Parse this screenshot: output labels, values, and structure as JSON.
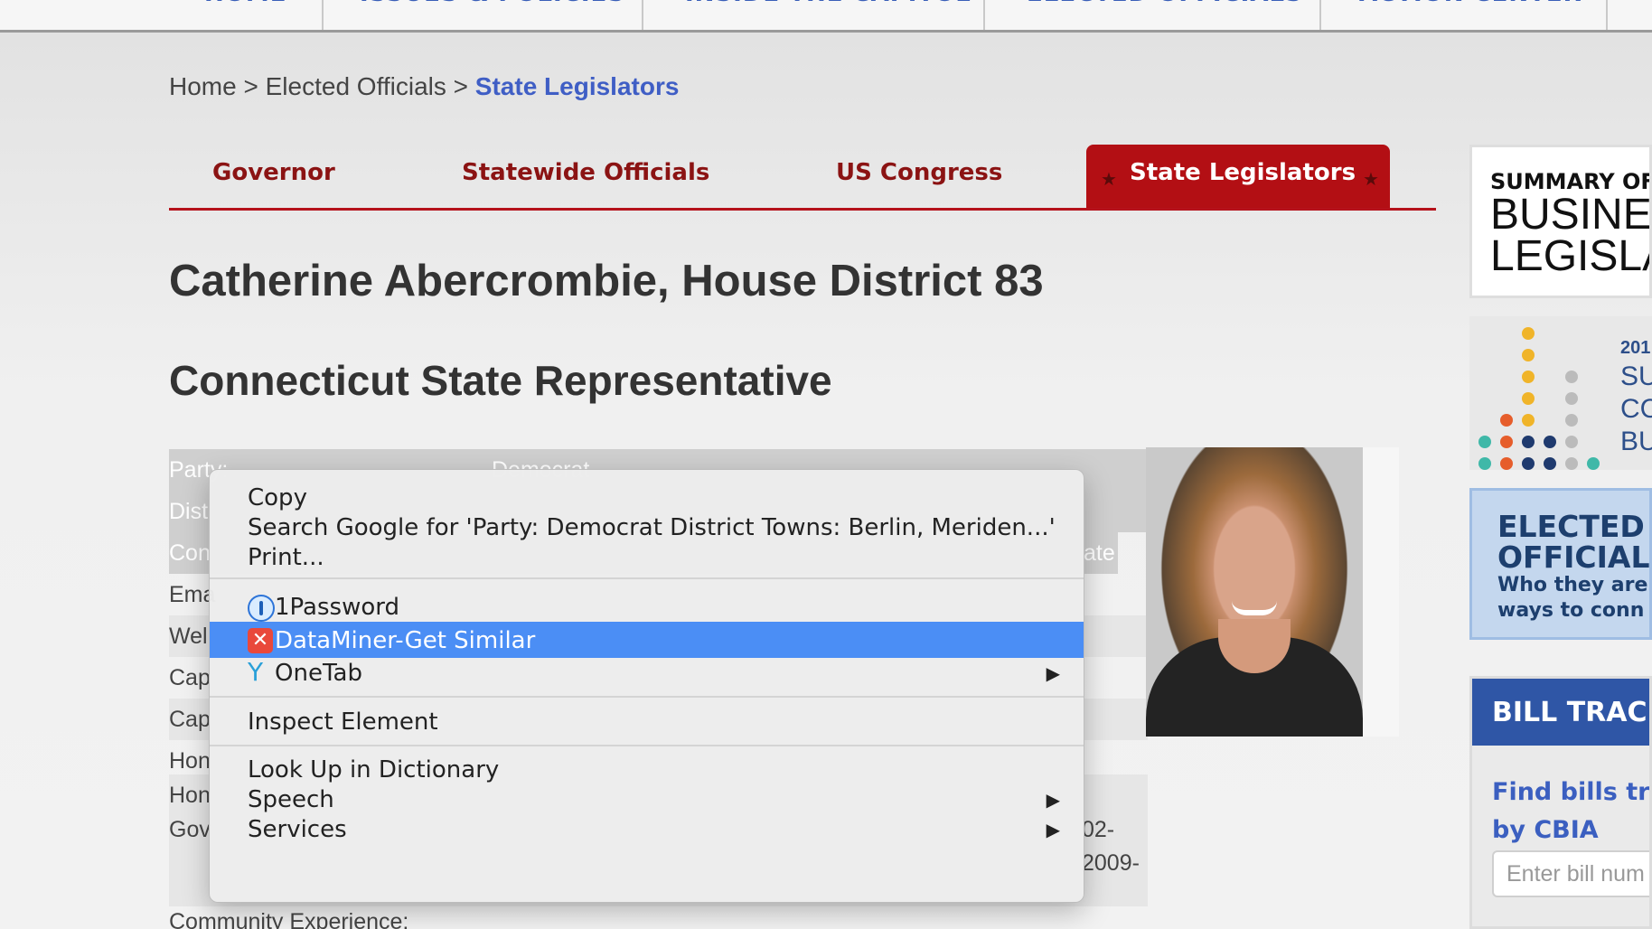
{
  "top_nav": {
    "items": [
      "HOME",
      "ISSUES & POLICIES",
      "INSIDE THE CAPITOL",
      "ELECTED OFFICIALS",
      "ACTION CENTER"
    ]
  },
  "breadcrumb": {
    "home": "Home",
    "sep1": " > ",
    "elected": "Elected Officials",
    "sep2": " > ",
    "current": "State Legislators"
  },
  "tabs": {
    "governor": "Governor",
    "statewide": "Statewide Officials",
    "congress": "US Congress",
    "legislators": "State Legislators",
    "star": "★"
  },
  "page": {
    "title": "Catherine Abercrombie, House District 83",
    "subtitle": "Connecticut State Representative",
    "community": "Community Experience:"
  },
  "info_rows": {
    "party_key": "Party:",
    "party_val": "Democrat",
    "dist_key": "Dist",
    "con_key": "Con",
    "con_val_tail": "ate",
    "email_key": "Ema",
    "web_key": "Wel",
    "cap1_key": "Cap",
    "cap2_key": "Cap",
    "home1_key": "Hon",
    "home2_key": "Hon",
    "gov_key": "Gov",
    "gov_val1_tail": "02-",
    "gov_val2_tail": "2009-"
  },
  "context_menu": {
    "copy": "Copy",
    "search_google": "Search Google for 'Party: Democrat District Towns: Berlin, Meriden...'",
    "print": "Print...",
    "onepassword": "1Password",
    "dataminer": "DataMiner-Get Similar",
    "onetab": "OneTab",
    "inspect": "Inspect Element",
    "lookup": "Look Up in Dictionary",
    "speech": "Speech",
    "services": "Services",
    "submenu_arrow": "▶"
  },
  "sidebar": {
    "ad1_line1": "SUMMARY OF",
    "ad1_line2": "BUSINES",
    "ad1_line3": "LEGISLA",
    "ad2_year": "201",
    "ad2_l1": "SU",
    "ad2_l2": "CC",
    "ad2_l3": "BU",
    "ad3_l1": "ELECTED",
    "ad3_l2": "OFFICIAL",
    "ad3_l3": "Who they are",
    "ad3_l4": "ways to conn",
    "bill_header": "BILL TRACK",
    "bill_find1": "Find bills trac",
    "bill_find2": "by CBIA",
    "bill_placeholder": "Enter bill num"
  },
  "colors": {
    "accent_red": "#b30f14",
    "link_blue": "#3f5ec5",
    "highlight": "#4b8ef5"
  }
}
